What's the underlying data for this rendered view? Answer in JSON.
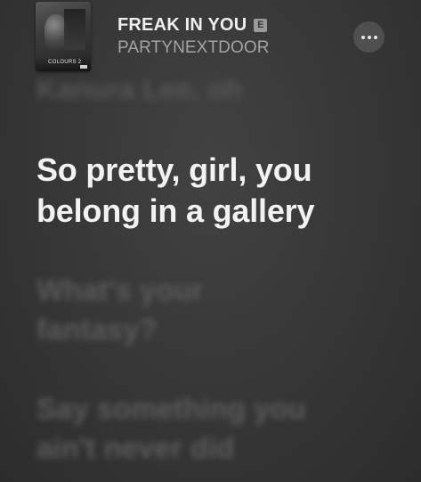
{
  "now_playing": {
    "title": "FREAK IN YOU",
    "explicit_badge": "E",
    "artist": "PARTYNEXTDOOR",
    "album_cover_text": "COLOURS 2"
  },
  "lyrics": {
    "previous": "Kanura Lee, oh",
    "current": [
      "So pretty, girl, you",
      "belong in a gallery"
    ],
    "next": [
      [
        "What's your",
        "fantasy?"
      ],
      [
        "Say something you",
        "ain't never did"
      ]
    ]
  },
  "controls": {
    "more_icon": "ellipsis-icon"
  }
}
